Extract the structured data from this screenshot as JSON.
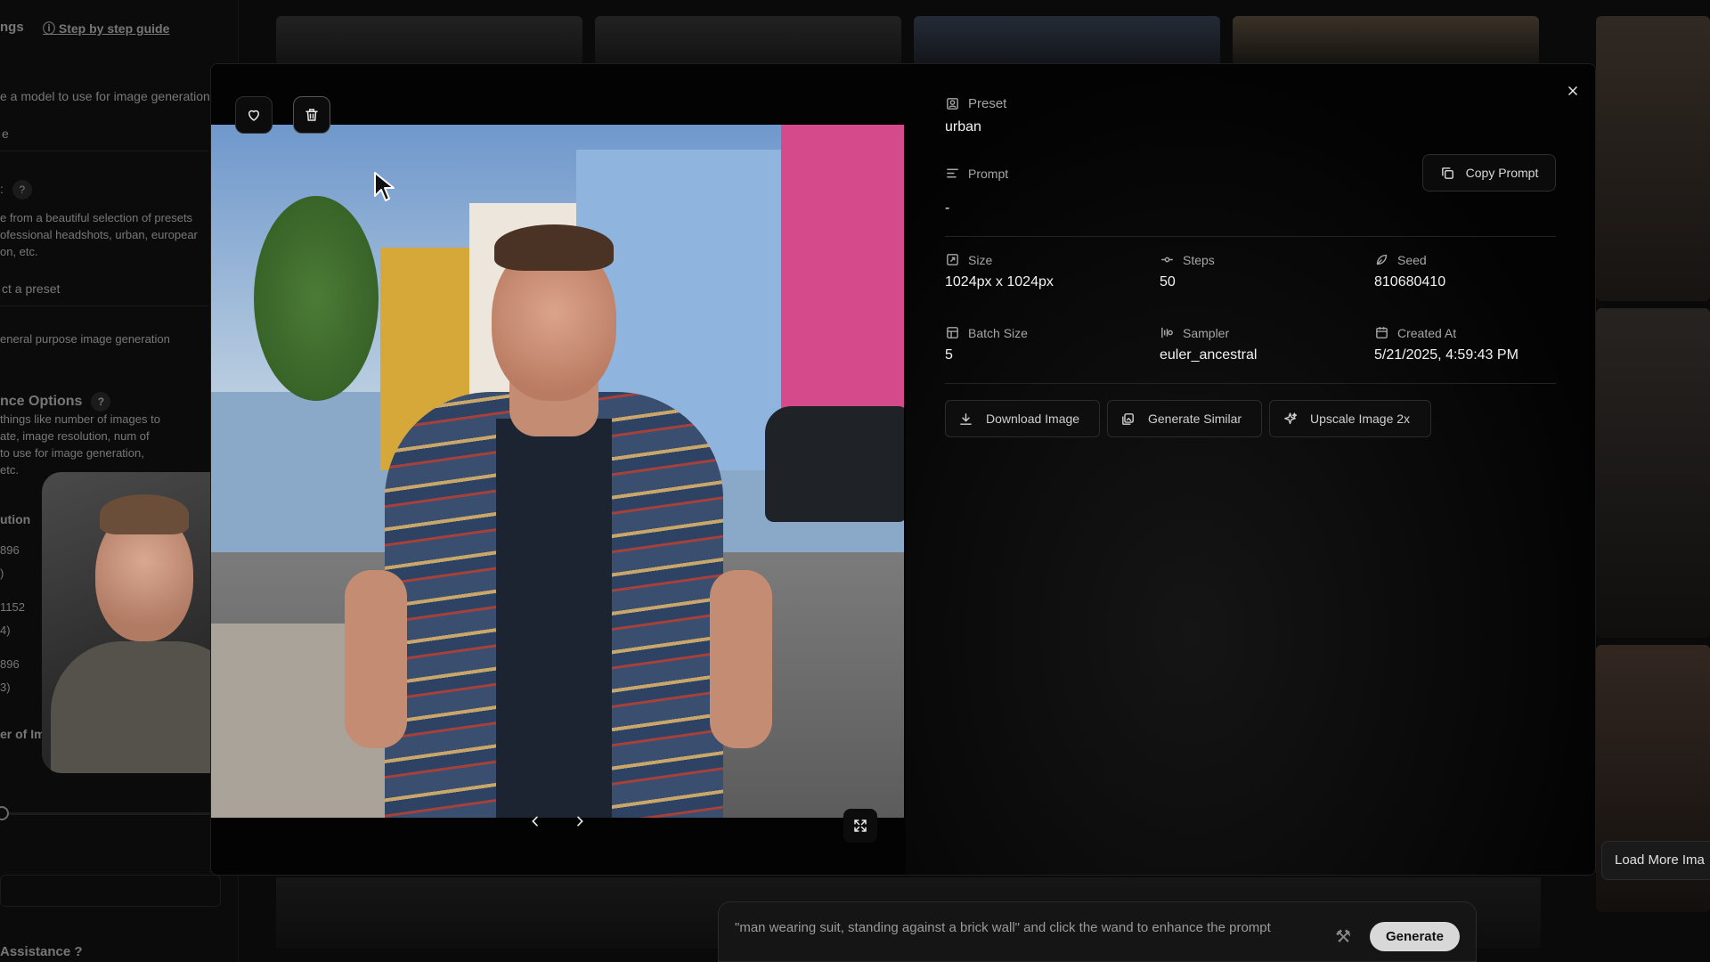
{
  "background": {
    "sidebar": {
      "title_fragment": "ngs",
      "guide_link": "Step by step guide",
      "model_hint": "e a model to use for image generation",
      "model_value": "e",
      "preset_header": ":",
      "preset_help": "?",
      "preset_desc_1": "e from a beautiful selection of presets",
      "preset_desc_2": "ofessional headshots, urban, europear",
      "preset_desc_3": "on, etc.",
      "preset_select": "ct a preset",
      "general": "eneral purpose image generation",
      "advanced_title": "nce Options",
      "advanced_help": "?",
      "adv_1": "things like number of images to",
      "adv_2": "ate, image resolution, num of",
      "adv_3": "to use for image generation,",
      "adv_4": "etc.",
      "resolution": "ution",
      "res_1a": "896",
      "res_1b": ")",
      "res_2a": "1152",
      "res_2b": "4)",
      "res_3a": "896",
      "res_3b": "3)",
      "num_images": "er of Im",
      "assistance": "Assistance ?"
    },
    "prompt_placeholder": "\"man wearing suit, standing against a brick wall\" and click the wand to enhance the prompt",
    "generate_label": "Generate",
    "load_more": "Load More Ima"
  },
  "modal": {
    "preset_label": "Preset",
    "preset_value": "urban",
    "prompt_label": "Prompt",
    "prompt_value": "-",
    "copy_prompt": "Copy Prompt",
    "fields": {
      "size_label": "Size",
      "size_value": "1024px x 1024px",
      "steps_label": "Steps",
      "steps_value": "50",
      "seed_label": "Seed",
      "seed_value": "810680410",
      "batch_label": "Batch Size",
      "batch_value": "5",
      "sampler_label": "Sampler",
      "sampler_value": "euler_ancestral",
      "created_label": "Created At",
      "created_value": "5/21/2025, 4:59:43 PM"
    },
    "actions": {
      "download": "Download Image",
      "similar": "Generate Similar",
      "upscale": "Upscale Image 2x"
    }
  },
  "colors": {
    "modal_bg": "#030303",
    "text_primary": "#f2f2f2",
    "text_secondary": "#a6a6a6"
  }
}
